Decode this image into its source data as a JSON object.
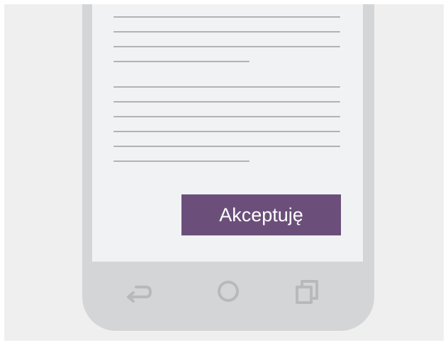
{
  "dialog": {
    "accept_label": "Akceptuję"
  },
  "navbar": {
    "back_icon": "back-arrow-icon",
    "home_icon": "home-circle-icon",
    "recents_icon": "recents-squares-icon"
  },
  "colors": {
    "background": "#efefef",
    "phone_frame": "#d4d5d6",
    "screen": "#f1f2f4",
    "text_line": "#b2b2b2",
    "accent": "#6b4f7a",
    "nav_icon": "#b8b9ba"
  }
}
